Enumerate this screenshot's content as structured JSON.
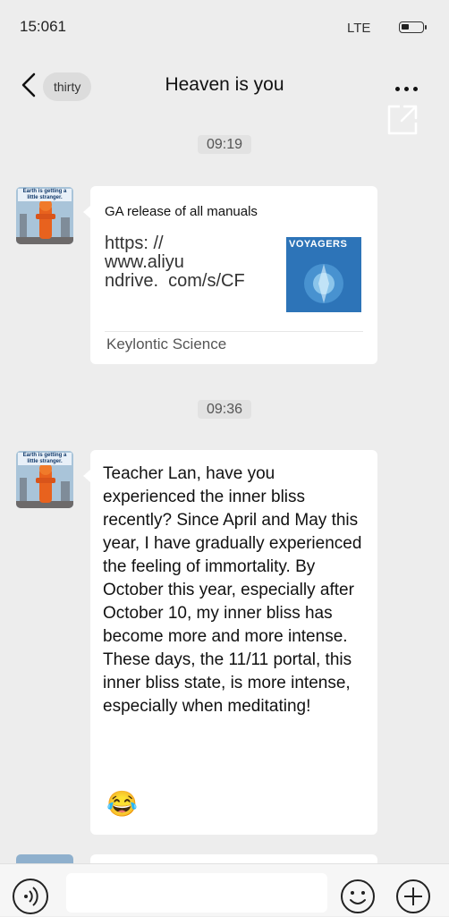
{
  "status_bar": {
    "time": "15:061",
    "network": "LTE",
    "battery_level": 0.35
  },
  "nav": {
    "back_label": "thirty",
    "title": "Heaven is you"
  },
  "avatar": {
    "caption": "Earth is getting a little stranger."
  },
  "messages": [
    {
      "timestamp": "09:19",
      "card": {
        "title": "GA release of all manuals",
        "link_text": "https: //\nwww.aliyu\nndrive.  com/s/CF",
        "thumbnail_text": "VOYAGERS",
        "source": "Keylontic Science"
      }
    },
    {
      "timestamp": "09:36",
      "text": "Teacher Lan, have you experienced the inner bliss recently? Since April and May this year, I have gradually experienced the feeling of immortality. By October this year, especially after October 10, my inner bliss has become more and more intense. These days, the 11/11 portal, this inner bliss state, is more intense, especially when meditating!",
      "emoji": "😂"
    }
  ],
  "colors": {
    "background": "#ededed",
    "bubble": "#ffffff",
    "thumbnail": "#2d74b8"
  },
  "icons": [
    "back-icon",
    "more-icon",
    "share-icon",
    "voice-icon",
    "emoji-icon",
    "plus-icon"
  ]
}
